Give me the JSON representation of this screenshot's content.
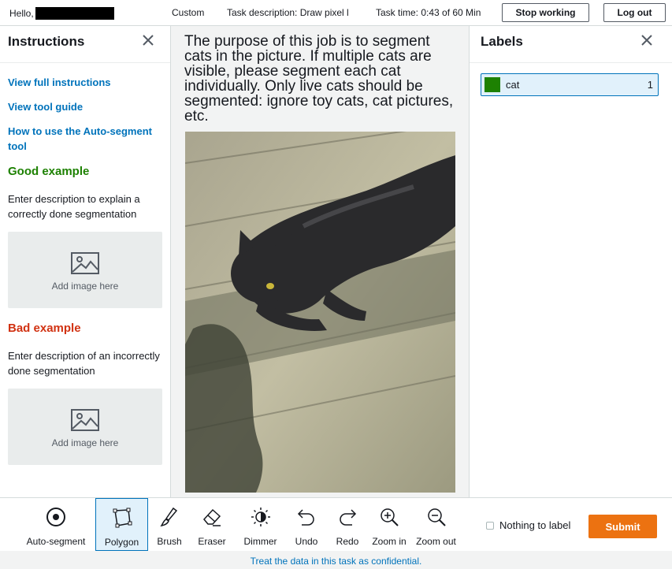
{
  "header": {
    "greeting": "Hello,",
    "mode": "Custom",
    "task_description": "Task description: Draw pixel l",
    "task_time": "Task time: 0:43 of 60 Min",
    "stop_label": "Stop working",
    "logout_label": "Log out"
  },
  "instructions": {
    "title": "Instructions",
    "links": [
      "View full instructions",
      "View tool guide",
      "How to use the Auto-segment tool"
    ],
    "good_title": "Good example",
    "good_desc": "Enter description to explain a correctly done segmentation",
    "good_image_text": "Add image here",
    "bad_title": "Bad example",
    "bad_desc": "Enter description of an incorrectly done segmentation",
    "bad_image_text": "Add image here"
  },
  "main": {
    "purpose": "The purpose of this job is to segment cats in the picture. If multiple cats are visible, please segment each cat individually. Only live cats should be segmented: ignore toy cats, cat pictures, etc."
  },
  "labels": {
    "title": "Labels",
    "items": [
      {
        "name": "cat",
        "count": "1",
        "color": "#1d8102"
      }
    ]
  },
  "toolbar": {
    "tools": [
      "Auto-segment",
      "Polygon",
      "Brush",
      "Eraser",
      "Dimmer",
      "Undo",
      "Redo",
      "Zoom in",
      "Zoom out"
    ],
    "active_tool": "Polygon",
    "nothing_label": "Nothing to label",
    "submit_label": "Submit"
  },
  "footer": {
    "text": "Treat the data in this task as confidential."
  },
  "colors": {
    "accent": "#0073bb",
    "submit": "#ec7211",
    "good": "#1d8102",
    "bad": "#d13212"
  }
}
